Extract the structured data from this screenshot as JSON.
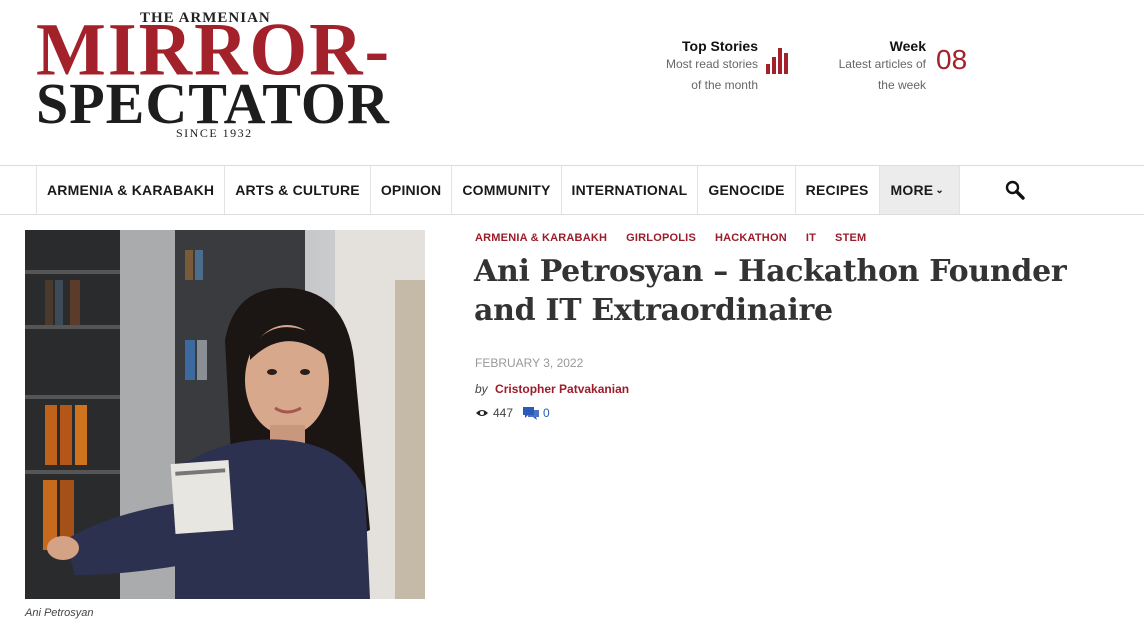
{
  "logo": {
    "the_armenian": "THE ARMENIAN",
    "mirror": "MIRROR-",
    "spectator": "SPECTATOR",
    "since": "SINCE 1932"
  },
  "header_widgets": {
    "top_stories": {
      "title": "Top Stories",
      "subtitle_line1": "Most read stories",
      "subtitle_line2": "of the month",
      "icon": "bar-chart-icon"
    },
    "week": {
      "title": "Week",
      "subtitle_line1": "Latest articles of",
      "subtitle_line2": "the week",
      "number": "08"
    }
  },
  "nav": {
    "items": [
      {
        "label": "ARMENIA & KARABAKH"
      },
      {
        "label": "ARTS & CULTURE"
      },
      {
        "label": "OPINION"
      },
      {
        "label": "COMMUNITY"
      },
      {
        "label": "INTERNATIONAL"
      },
      {
        "label": "GENOCIDE"
      },
      {
        "label": "RECIPES"
      }
    ],
    "more_label": "MORE",
    "search_icon": "search-icon"
  },
  "article": {
    "categories": [
      "ARMENIA & KARABAKH",
      "GIRLOPOLIS",
      "HACKATHON",
      "IT",
      "STEM"
    ],
    "title": "Ani Petrosyan – Hackathon Founder and IT Extraordinaire",
    "date": "FEBRUARY 3, 2022",
    "by": "by",
    "author": "Cristopher Patvakanian",
    "views": "447",
    "comments": "0",
    "image_caption": "Ani Petrosyan"
  },
  "colors": {
    "brand_red": "#a3212b",
    "link_red": "#9b1c2a",
    "comment_blue": "#2a5bb8"
  }
}
